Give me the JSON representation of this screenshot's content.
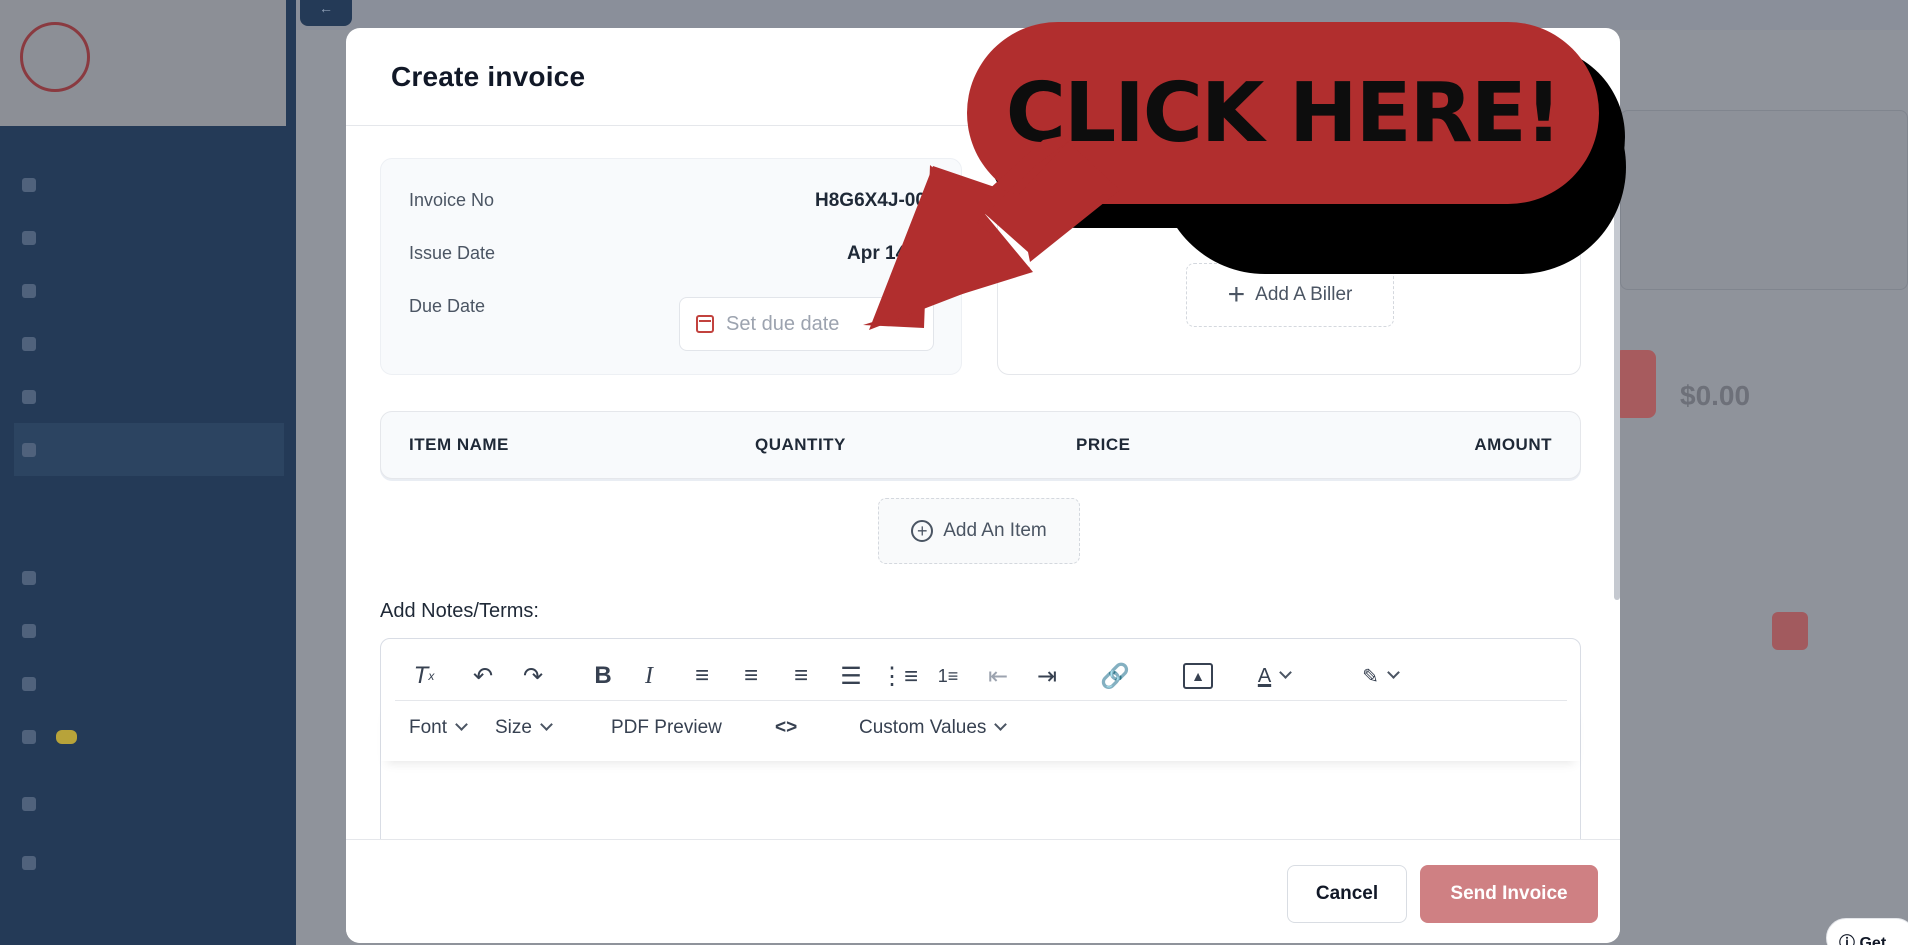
{
  "modal": {
    "title": "Create invoice",
    "invoice_no_label": "Invoice No",
    "invoice_no_value": "H8G6X4J-00",
    "issue_date_label": "Issue Date",
    "issue_date_value": "Apr 14, 2",
    "due_date_label": "Due Date",
    "due_date_placeholder": "Set due date",
    "add_biller": "Add A Biller",
    "table_headers": [
      "ITEM NAME",
      "QUANTITY",
      "PRICE",
      "AMOUNT"
    ],
    "add_item": "Add An Item",
    "notes_label": "Add Notes/Terms:",
    "editor": {
      "font": "Font",
      "size": "Size",
      "pdf_preview": "PDF Preview",
      "code": "<>",
      "custom_values": "Custom Values"
    },
    "cancel": "Cancel",
    "send": "Send Invoice"
  },
  "callout": {
    "text": "CLICK HERE!",
    "color": "#b12e2e"
  },
  "background": {
    "amount": "$0.00",
    "help": "Get"
  },
  "icons": [
    "clear-format-icon",
    "undo-icon",
    "redo-icon",
    "bold-icon",
    "italic-icon",
    "align-left-icon",
    "align-center-icon",
    "align-right-icon",
    "justify-icon",
    "bullet-list-icon",
    "numbered-list-icon",
    "outdent-icon",
    "indent-icon",
    "link-icon",
    "image-icon",
    "text-color-icon",
    "highlight-icon",
    "calendar-icon"
  ]
}
